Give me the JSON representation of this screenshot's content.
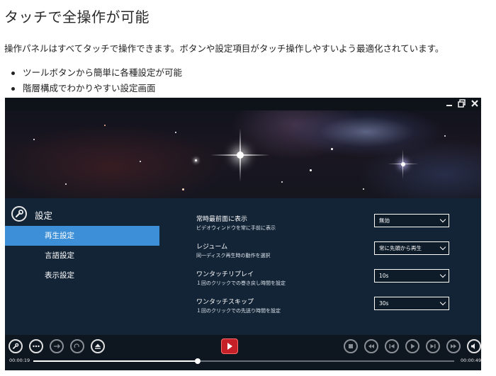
{
  "page": {
    "heading": "タッチで全操作が可能",
    "description": "操作パネルはすべてタッチで操作できます。ボタンや設定項目がタッチ操作しやすいよう最適化されています。",
    "bullets": [
      "ツールボタンから簡単に各種設定が可能",
      "階層構成でわかりやすい設定画面"
    ]
  },
  "window": {
    "icons": [
      "minimize-icon",
      "restore-icon",
      "close-icon"
    ]
  },
  "settings": {
    "title": "設定",
    "title_icon": "wrench-icon",
    "menu": [
      {
        "label": "再生設定",
        "active": true
      },
      {
        "label": "言語設定",
        "active": false
      },
      {
        "label": "表示設定",
        "active": false
      }
    ],
    "items": [
      {
        "label": "常時最前面に表示",
        "sub": "ビデオウィンドウを常に手前に表示",
        "value": "無効"
      },
      {
        "label": "レジューム",
        "sub": "同一ディスク再生時の動作を選択",
        "value": "常に先頭から再生"
      },
      {
        "label": "ワンタッチリプレイ",
        "sub": "１回のクリックでの巻き戻し時間を設定",
        "value": "10s"
      },
      {
        "label": "ワンタッチスキップ",
        "sub": "１回のクリックでの先送り時間を設定",
        "value": "30s"
      }
    ]
  },
  "player": {
    "current_time": "00:00:19",
    "total_time": "00:00:49",
    "progress": 0.39,
    "accent": "#3d8fd8",
    "logo_color": "#c51f27"
  }
}
